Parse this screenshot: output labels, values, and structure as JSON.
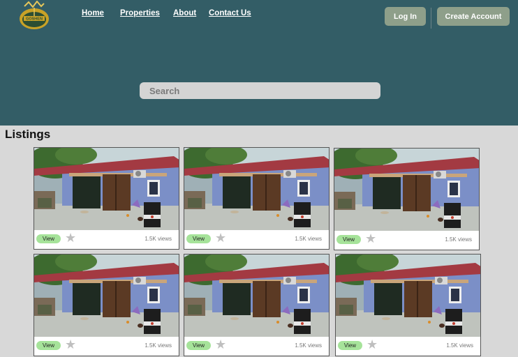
{
  "header": {
    "logo_text": "GOSHEN",
    "nav": [
      "Home",
      "Properties",
      "About",
      "Contact Us"
    ],
    "login_label": "Log In",
    "create_account_label": "Create Account",
    "search_placeholder": "Search"
  },
  "listings": {
    "title": "Listings",
    "cards": [
      {
        "view_label": "View",
        "views": "1.5K views"
      },
      {
        "view_label": "View",
        "views": "1.5K views"
      },
      {
        "view_label": "View",
        "views": "1.5K views"
      },
      {
        "view_label": "View",
        "views": "1.5K views"
      },
      {
        "view_label": "View",
        "views": "1.5K views"
      },
      {
        "view_label": "View",
        "views": "1.5K views"
      }
    ]
  },
  "colors": {
    "header_bg": "#335d66",
    "button_bg": "#8e9f8a",
    "view_button_bg": "#a6e39a",
    "page_bg": "#d8d8d8"
  }
}
